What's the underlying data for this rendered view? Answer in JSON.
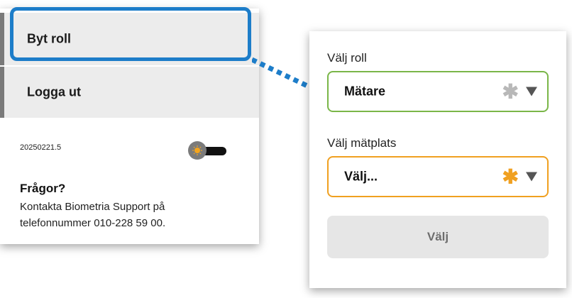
{
  "menu": {
    "switch_role": "Byt roll",
    "logout": "Logga ut",
    "version": "20250221.5",
    "faq_title": "Frågor?",
    "faq_text": "Kontakta Biometria Support på telefonnummer 010-228 59 00."
  },
  "dialog": {
    "role_label": "Välj roll",
    "role_value": "Mätare",
    "role_required_color": "#b8b8b8",
    "place_label": "Välj mätplats",
    "place_value": "Välj...",
    "place_required_color": "#f0a020",
    "submit_label": "Välj"
  },
  "colors": {
    "highlight": "#1d7dc9",
    "role_border": "#7ab648",
    "place_border": "#f0a020"
  },
  "icons": {
    "theme_toggle": "sun-icon",
    "dropdown": "chevron-down-icon"
  }
}
